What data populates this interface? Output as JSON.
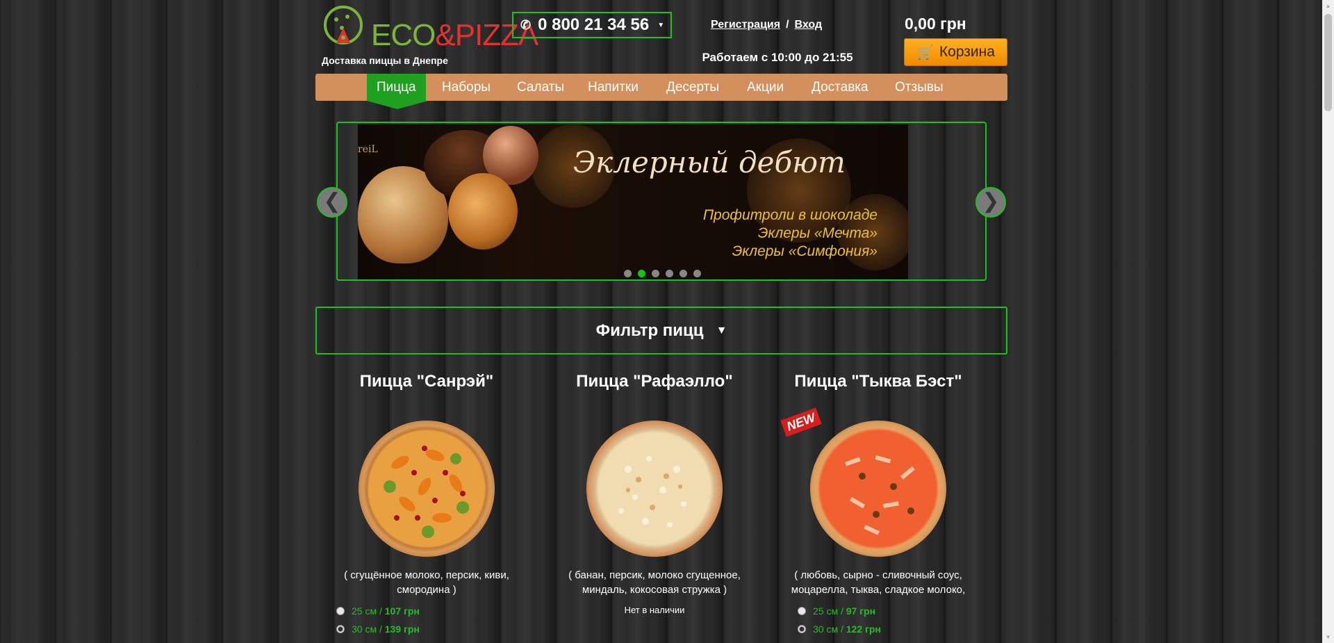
{
  "brand": {
    "logo_left": "ECO",
    "logo_amp": "&",
    "logo_right": "PIZZA",
    "tagline": "Доставка пиццы в Днепре"
  },
  "header": {
    "phone": "0 800 21 34 56",
    "register": "Регистрация",
    "separator": "/",
    "login": "Вход",
    "hours": "Работаем с 10:00 до 21:55",
    "cart_total": "0,00 грн",
    "cart_label": "Корзина"
  },
  "nav": [
    "Пицца",
    "Наборы",
    "Салаты",
    "Напитки",
    "Десерты",
    "Акции",
    "Доставка",
    "Отзывы"
  ],
  "slider": {
    "brand": "reiL",
    "title": "Эклерный дебют",
    "lines": [
      "Профитроли в шоколаде",
      "Эклеры «Мечта»",
      "Эклеры «Симфония»"
    ],
    "slides_count": 6,
    "active_slide": 2,
    "prev": "❮",
    "next": "❯"
  },
  "filter": {
    "label": "Фильтр пицц",
    "arrow": "▼"
  },
  "products": [
    {
      "title": "Пицца \"Санрэй\"",
      "desc_line1": "( сгущённое молоко, персик, киви,",
      "desc_line2": "смородина )",
      "opt1_size": "25 см /",
      "opt1_price": "107 грн",
      "opt2_size": "30 см /",
      "opt2_price": "139 грн"
    },
    {
      "title": "Пицца \"Рафаэлло\"",
      "desc_line1": "( банан, персик,  молоко сгущенное,",
      "desc_line2": "миндаль, кокосовая стружка )",
      "unavailable": "Нет в наличии"
    },
    {
      "title": "Пицца \"Тыква Бэст\"",
      "badge": "NEW",
      "desc_line1": "( любовь, сырно - сливочный соус,",
      "desc_line2": "моцарелла, тыква, сладкое молоко,",
      "opt1_size": "25 см /",
      "opt1_price": "97 грн",
      "opt2_size": "30 см /",
      "opt2_price": "122 грн"
    }
  ],
  "colors": {
    "accent_green": "#1ec21e",
    "nav_bg": "#d4905c",
    "cart_orange": "#f8a012"
  },
  "icons": {
    "phone": "phone-icon",
    "cart": "cart-icon",
    "caret": "chevron-down-icon"
  }
}
